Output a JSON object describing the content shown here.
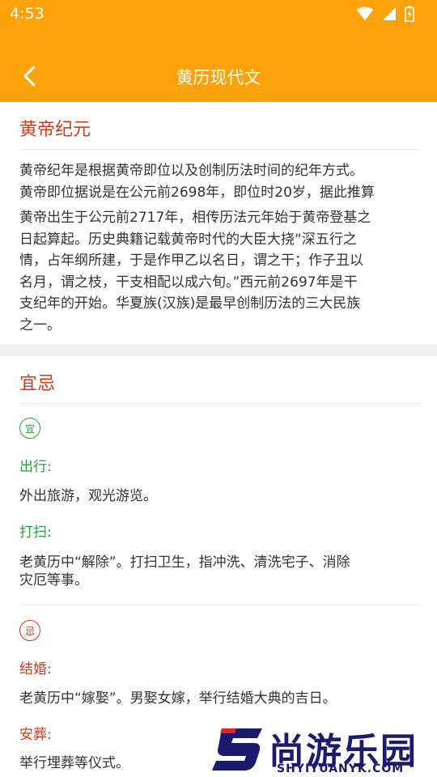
{
  "status_bar": {
    "time": "4:53"
  },
  "header": {
    "title": "黄历现代文"
  },
  "section1": {
    "title": "黄帝纪元",
    "body_lines": [
      "黄帝纪年是根据黄帝即位以及创制历法时间的纪年方式。",
      "黄帝即位据说是在公元前2698年，即位时20岁，据此推算",
      "黄帝出生于公元前2717年，相传历法元年始于黄帝登基之",
      "日起算起。历史典籍记载黄帝时代的大臣大挠“深五行之",
      "情，占年纲所建，于是作甲乙以名日，谓之干；作子丑以",
      "名月，谓之枝，干支相配以成六旬。”西元前2697年是干",
      "支纪年的开始。华夏族(汉族)是最早创制历法的三大民族",
      "之一。"
    ]
  },
  "section2": {
    "title": "宜忌",
    "good_badge": "宜",
    "bad_badge": "忌",
    "good_items": [
      {
        "label": "出行:",
        "desc": "外出旅游，观光游览。"
      },
      {
        "label": "打扫:",
        "desc_lines": [
          "老黄历中“解除”。打扫卫生，指冲洗、清洗宅子、消除",
          "灾厄等事。"
        ]
      }
    ],
    "bad_items": [
      {
        "label": "结婚:",
        "desc": "老黄历中“嫁娶”。男娶女嫁，举行结婚大典的吉日。"
      },
      {
        "label": "安葬:",
        "desc": "举行埋葬等仪式。"
      }
    ]
  },
  "watermark": {
    "text": "尚游乐园",
    "url": "SHYIYUANYK.COM"
  },
  "colors": {
    "header": "#FBA20A",
    "section_title": "#D23A1B",
    "good": "#2E9D3B",
    "bad": "#D23A1B"
  },
  "icons": [
    "wifi-icon",
    "signal-icon",
    "battery-icon",
    "back-arrow-icon"
  ]
}
